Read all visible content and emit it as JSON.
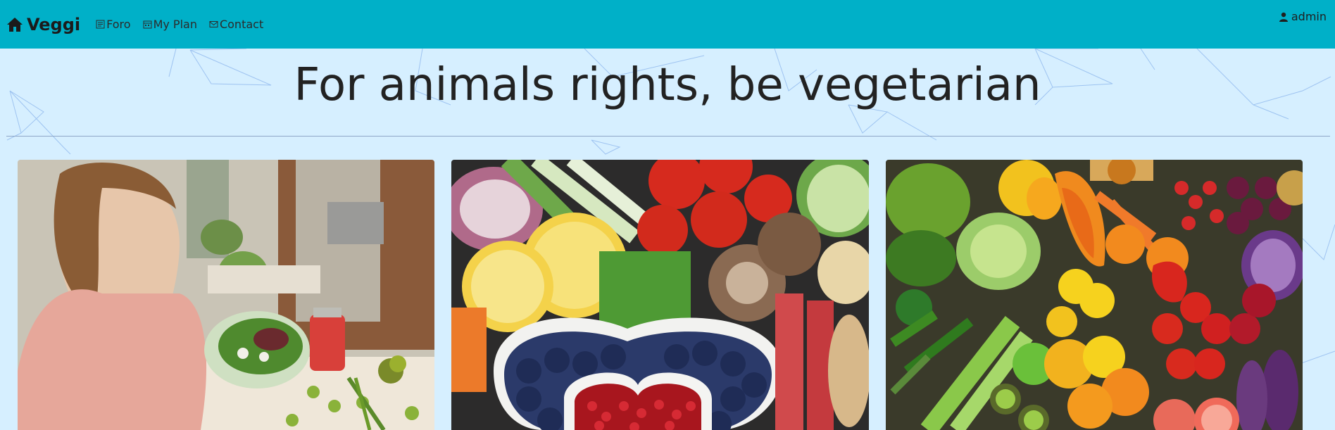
{
  "navbar": {
    "brand": "Veggi",
    "links": [
      {
        "label": "Foro",
        "icon": "forum-icon"
      },
      {
        "label": "My Plan",
        "icon": "calendar-icon"
      },
      {
        "label": "Contact",
        "icon": "mail-icon"
      }
    ],
    "user": "admin"
  },
  "hero": {
    "title": "For animals rights, be vegetarian"
  },
  "cards": [
    {
      "image": "woman-eating-salad"
    },
    {
      "image": "lemons-tomatoes-blueberries-pomegranate"
    },
    {
      "image": "rainbow-vegetables-and-fruits"
    }
  ],
  "colors": {
    "navbar": "#00b0c8",
    "background": "#d6efff",
    "lines": "#5a8fe0"
  }
}
